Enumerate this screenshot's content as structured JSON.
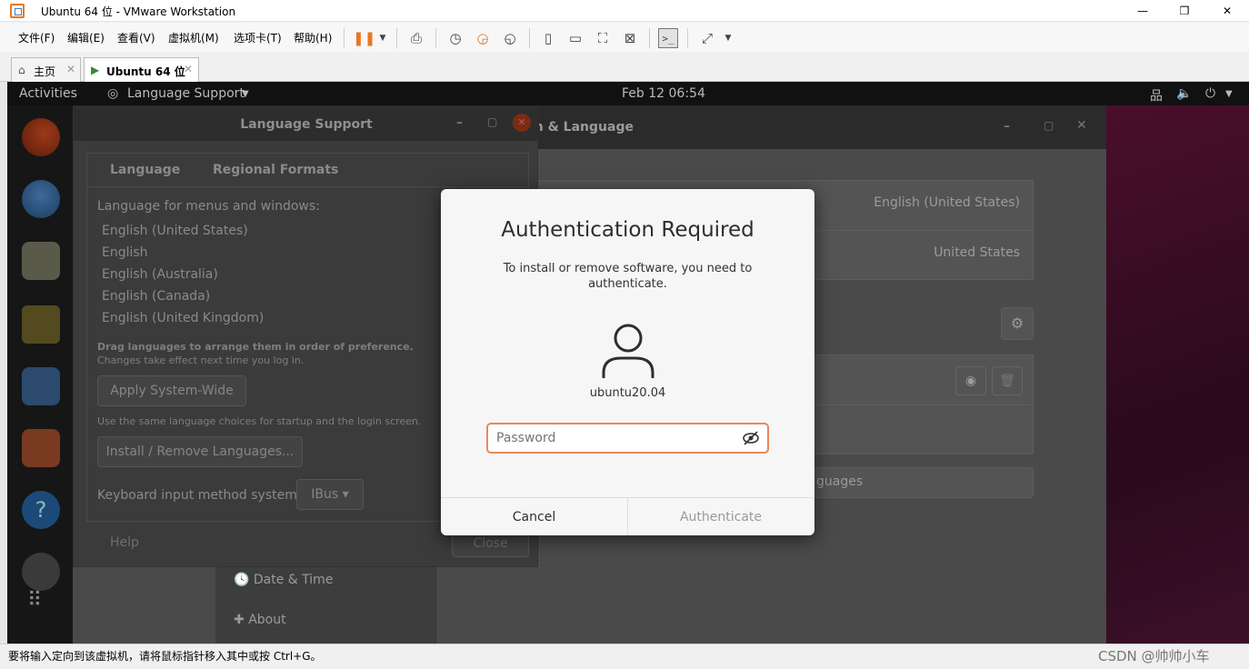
{
  "vmware": {
    "window_title": "Ubuntu 64 位 - VMware Workstation",
    "win_min": "—",
    "win_max": "❐",
    "win_close": "✕",
    "menu": [
      "文件(F)",
      "编辑(E)",
      "查看(V)",
      "虚拟机(M)",
      "选项卡(T)",
      "帮助(H)"
    ],
    "tabs": [
      {
        "label": "主页",
        "icon": "home-icon"
      },
      {
        "label": "Ubuntu 64 位",
        "icon": "vm-icon"
      }
    ],
    "status_text": "要将输入定向到该虚拟机，请将鼠标指针移入其中或按 Ctrl+G。",
    "watermark": "CSDN @帅帅小车"
  },
  "gnome": {
    "activities": "Activities",
    "app_menu": "Language Support",
    "clock": "Feb 12  06:54"
  },
  "region_window": {
    "title": "Region & Language",
    "language_value": "English (United States)",
    "formats_value": "United States",
    "manage_languages_partial": "guages",
    "sidebar": [
      "Date & Time",
      "About"
    ]
  },
  "language_window": {
    "title": "Language Support",
    "tabs": [
      "Language",
      "Regional Formats"
    ],
    "label_menus": "Language for menus and windows:",
    "languages": [
      "English (United States)",
      "English",
      "English (Australia)",
      "English (Canada)",
      "English (United Kingdom)"
    ],
    "drag_note": "Drag languages to arrange them in order of preference.",
    "drag_note2": "Changes take effect next time you log in.",
    "apply_btn": "Apply System-Wide",
    "same_note": "Use the same language choices for startup and the login screen.",
    "install_btn": "Install / Remove Languages...",
    "input_label": "Keyboard input method system:",
    "input_value": "IBus",
    "help": "Help",
    "close": "Close"
  },
  "auth_dialog": {
    "title": "Authentication Required",
    "message": "To install or remove software, you need to authenticate.",
    "username": "ubuntu20.04",
    "password_placeholder": "Password",
    "cancel": "Cancel",
    "authenticate": "Authenticate"
  }
}
